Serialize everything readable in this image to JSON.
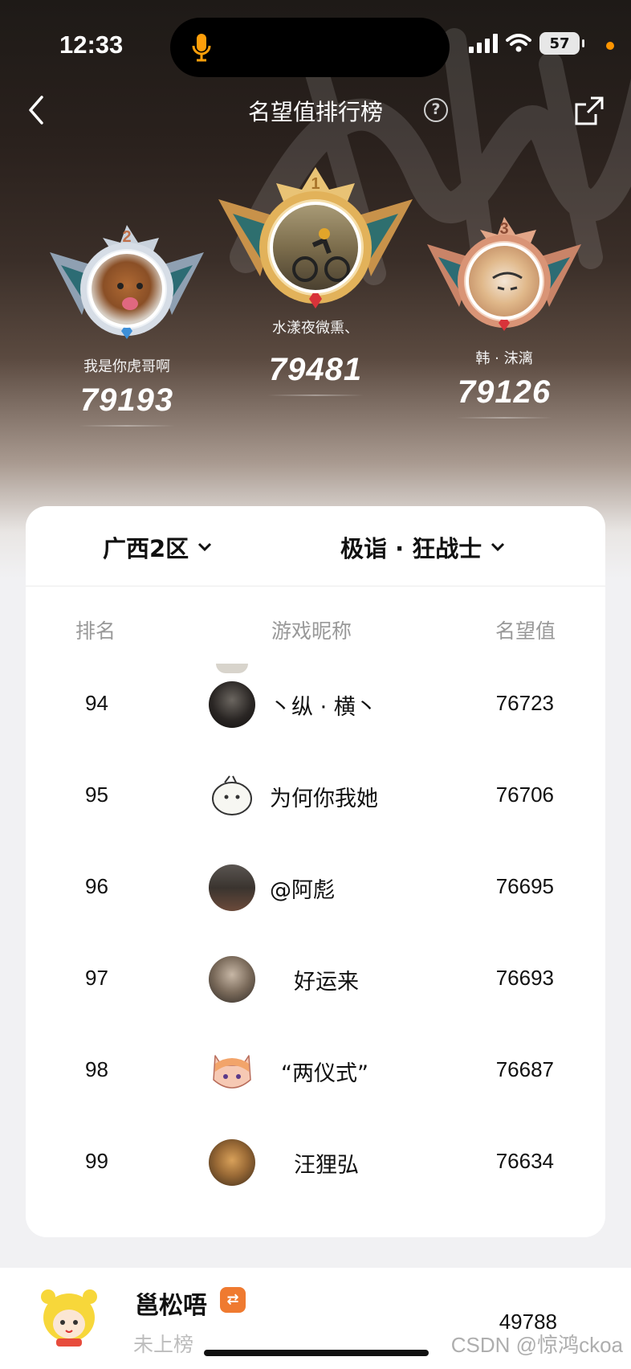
{
  "status": {
    "time": "12:33",
    "battery": "57"
  },
  "nav": {
    "title": "名望值排行榜"
  },
  "podium": [
    {
      "rank": "2",
      "name": "我是你虎哥啊",
      "score": "79193"
    },
    {
      "rank": "1",
      "name": "水漾夜微熏、",
      "score": "79481"
    },
    {
      "rank": "3",
      "name": "韩 · 沫漓",
      "score": "79126"
    }
  ],
  "filters": {
    "region": "广西2区",
    "class": "极诣 · 狂战士"
  },
  "columns": {
    "rank": "排名",
    "nickname": "游戏昵称",
    "value": "名望值"
  },
  "rows": [
    {
      "rank": "94",
      "nickname": "丶纵 · 横丶",
      "value": "76723"
    },
    {
      "rank": "95",
      "nickname": "为何你我她",
      "value": "76706"
    },
    {
      "rank": "96",
      "nickname": "@阿彪",
      "value": "76695"
    },
    {
      "rank": "97",
      "nickname": "好运来",
      "value": "76693"
    },
    {
      "rank": "98",
      "nickname": "“两仪式”",
      "value": "76687"
    },
    {
      "rank": "99",
      "nickname": "汪狸弘",
      "value": "76634"
    }
  ],
  "me": {
    "name": "邕松唔",
    "status": "未上榜",
    "value": "49788"
  },
  "watermark": "CSDN @惊鸿ckoa",
  "colors": {
    "accent": "#ef7a30",
    "gold": "#e2b25a",
    "silver": "#b9c3cf",
    "bronze": "#d99476"
  }
}
